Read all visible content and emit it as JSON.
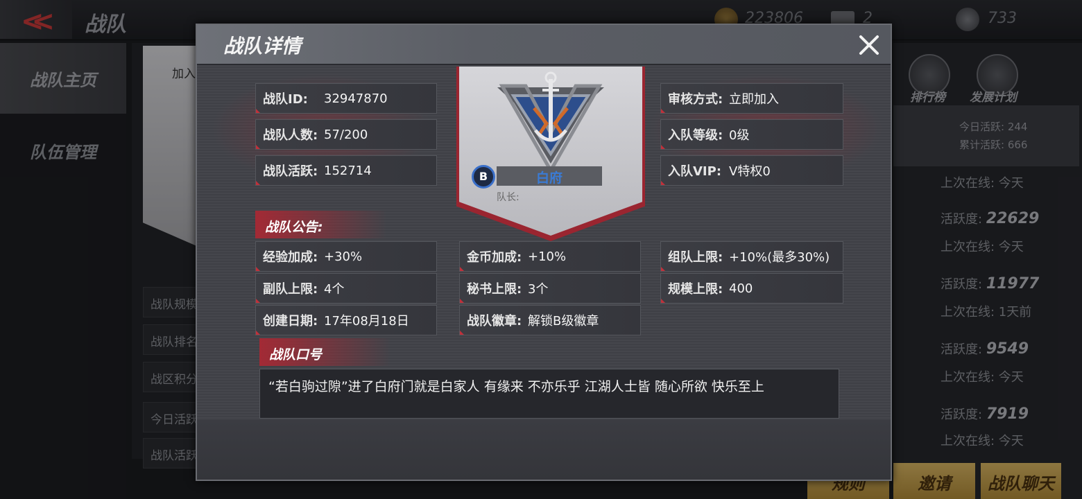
{
  "topbar": {
    "title": "战队",
    "coins": "223806",
    "diamonds": "2",
    "honor": "733"
  },
  "left_nav": [
    {
      "label": "战队主页"
    },
    {
      "label": "队伍管理"
    }
  ],
  "bg_rows": [
    "战队规模",
    "战队排名",
    "战区积分",
    "今日活跃",
    "战队活跃"
  ],
  "bg_join_label": "加入",
  "right_panel": {
    "ranking_label": "排行榜",
    "plan_label": "发展计划",
    "today_active": "今日活跃: 244",
    "total_active": "累计活跃: 666",
    "members": [
      {
        "last_online": "上次在线: 今天",
        "activity_label": "活跃度:",
        "activity": "22629"
      },
      {
        "last_online": "上次在线: 今天",
        "activity_label": "活跃度:",
        "activity": "11977"
      },
      {
        "last_online": "上次在线: 1天前",
        "activity_label": "活跃度:",
        "activity": "9549"
      },
      {
        "last_online": "上次在线: 今天",
        "activity_label": "活跃度:",
        "activity": "7919"
      },
      {
        "last_online": "上次在线: 今天"
      }
    ],
    "invite_label": "邀请",
    "chat_label": "战队聊天",
    "rules_label": "规则"
  },
  "modal": {
    "title": "战队详情",
    "team_id_label": "战队ID:",
    "team_id": "32947870",
    "members_label": "战队人数:",
    "members": "57/200",
    "activity_label": "战队活跃:",
    "activity": "152714",
    "review_label": "审核方式:",
    "review": "立即加入",
    "join_level_label": "入队等级:",
    "join_level": "0级",
    "join_vip_label": "入队VIP:",
    "join_vip": "V特权0",
    "team_name": "白府",
    "team_badge": "B",
    "captain_label": "队长:",
    "notice_label": "战队公告:",
    "stats": [
      {
        "label": "经验加成:",
        "value": "+30%"
      },
      {
        "label": "金币加成:",
        "value": "+10%"
      },
      {
        "label": "组队上限:",
        "value": "+10%(最多30%)"
      },
      {
        "label": "副队上限:",
        "value": "4个"
      },
      {
        "label": "秘书上限:",
        "value": "3个"
      },
      {
        "label": "规模上限:",
        "value": "400"
      },
      {
        "label": "创建日期:",
        "value": "17年08月18日"
      },
      {
        "label": "战队徽章:",
        "value": "解锁B级徽章"
      }
    ],
    "slogan_label": "战队口号",
    "slogan": "“若白驹过隙”进了白府门就是白家人 有缘来 不亦乐乎  江湖人士皆  随心所欲  快乐至上"
  },
  "colors": {
    "accent_red": "#a32a35",
    "name_blue": "#3a7bd5",
    "gold_button": "#d9b663"
  }
}
